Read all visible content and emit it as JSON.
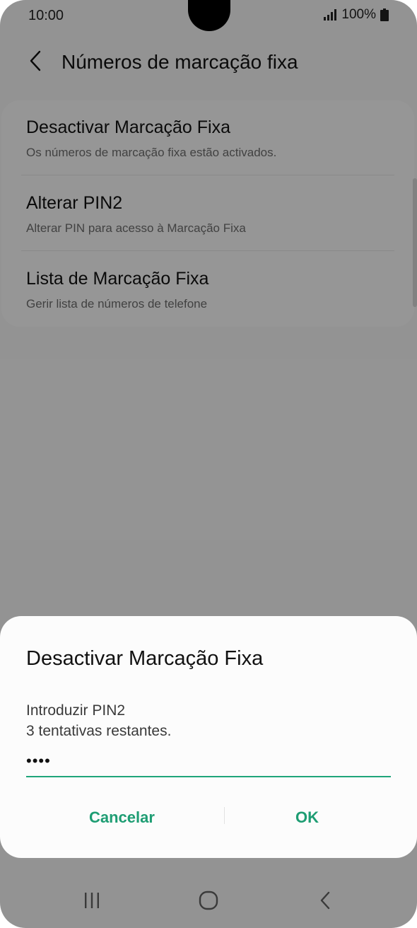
{
  "status_bar": {
    "time": "10:00",
    "battery": "100%"
  },
  "header": {
    "title": "Números de marcação fixa"
  },
  "settings": {
    "items": [
      {
        "title": "Desactivar Marcação Fixa",
        "subtitle": "Os números de marcação fixa estão activados."
      },
      {
        "title": "Alterar PIN2",
        "subtitle": "Alterar PIN para acesso à Marcação Fixa"
      },
      {
        "title": "Lista de Marcação Fixa",
        "subtitle": "Gerir lista de números de telefone"
      }
    ]
  },
  "dialog": {
    "title": "Desactivar Marcação Fixa",
    "label": "Introduzir PIN2",
    "hint": "3 tentativas restantes.",
    "input_value": "••••",
    "cancel_label": "Cancelar",
    "ok_label": "OK"
  },
  "icons": {
    "back": "chevron-left-icon",
    "signal": "signal-icon",
    "battery": "battery-icon",
    "nav_recents": "recents-icon",
    "nav_home": "home-icon",
    "nav_back": "back-icon"
  },
  "colors": {
    "accent": "#1e9d73",
    "input_underline": "#1fa57a",
    "scrim": "rgba(0,0,0,0.4)"
  }
}
